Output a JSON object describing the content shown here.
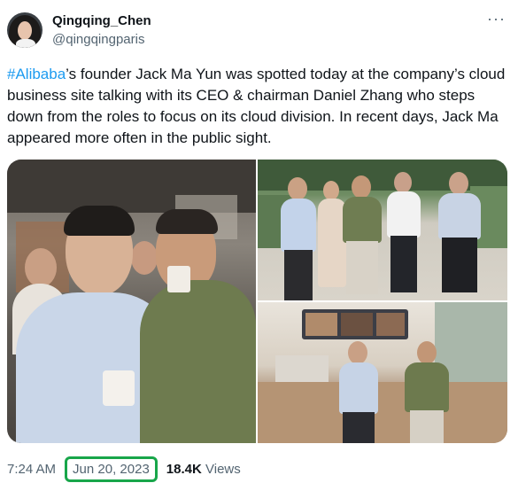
{
  "author": {
    "display_name": "Qingqing_Chen",
    "handle": "@qingqingparis"
  },
  "more_icon": "more-horizontal-icon",
  "tweet": {
    "hashtag": "#Alibaba",
    "text_rest": "’s founder Jack Ma Yun was spotted today at the company’s cloud business site talking with its CEO & chairman Daniel Zhang who steps down from the roles to focus on its cloud division. In recent days, Jack Ma appeared more often in the public sight."
  },
  "footer": {
    "time": "7:24 AM",
    "separator": "·",
    "date": "Jun 20, 2023",
    "views_count": "18.4K",
    "views_label": "Views"
  },
  "colors": {
    "link": "#1d9bf0",
    "secondary_text": "#536471",
    "highlight_box": "#18a64a"
  }
}
